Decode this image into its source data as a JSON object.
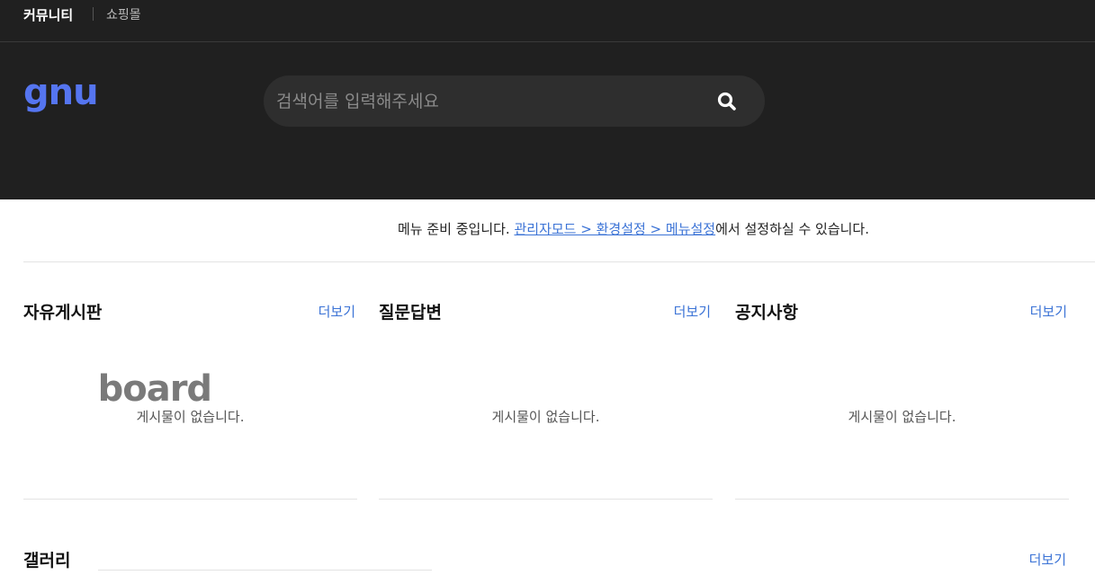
{
  "topnav": {
    "community": "커뮤니티",
    "shop": "쇼핑몰"
  },
  "logo": {
    "part1": "gnu",
    "part2": "board",
    "accent": "#5575f0"
  },
  "search": {
    "placeholder": "검색어를 입력해주세요",
    "icon": "search-icon"
  },
  "notice": {
    "prefix": "메뉴 준비 중입니다. ",
    "link": "관리자모드 > 환경설정 > 메뉴설정",
    "suffix": "에서 설정하실 수 있습니다."
  },
  "boards": [
    {
      "title": "자유게시판",
      "more": "더보기",
      "empty": "게시물이 없습니다."
    },
    {
      "title": "질문답변",
      "more": "더보기",
      "empty": "게시물이 없습니다."
    },
    {
      "title": "공지사항",
      "more": "더보기",
      "empty": "게시물이 없습니다."
    }
  ],
  "gallery": {
    "title": "갤러리",
    "more": "더보기"
  }
}
